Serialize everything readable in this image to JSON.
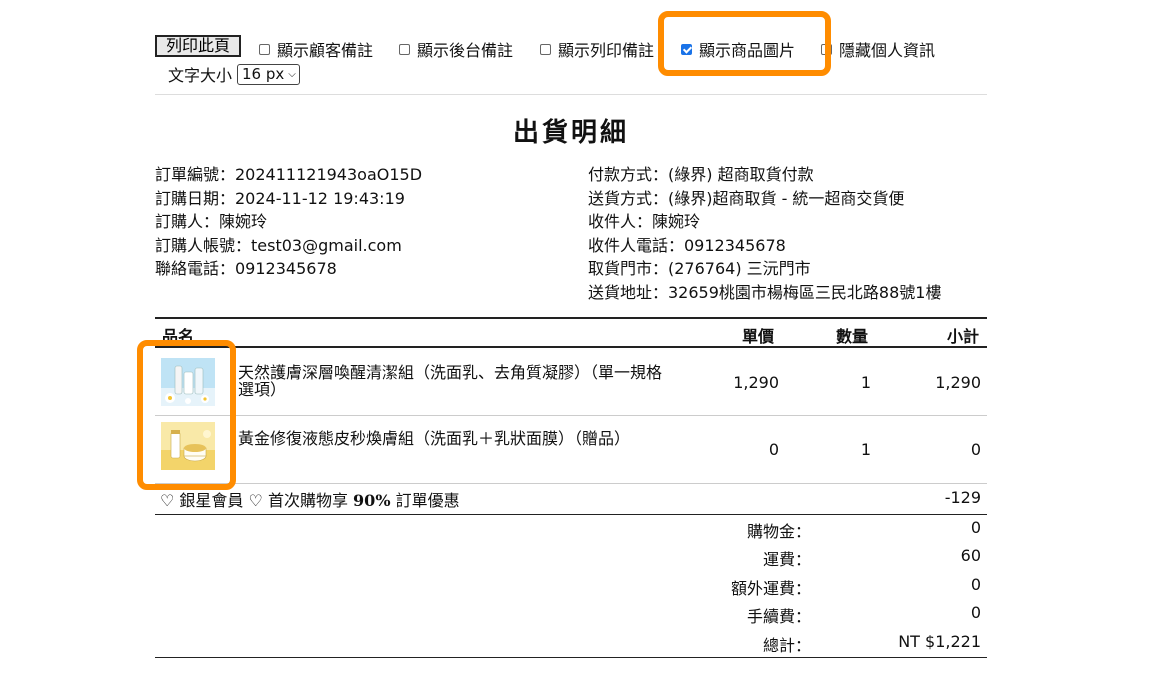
{
  "toolbar": {
    "print_button": "列印此頁",
    "options": [
      {
        "label": "顯示顧客備註",
        "checked": false
      },
      {
        "label": "顯示後台備註",
        "checked": false
      },
      {
        "label": "顯示列印備註",
        "checked": false
      },
      {
        "label": "顯示商品圖片",
        "checked": true
      },
      {
        "label": "隱藏個人資訊",
        "checked": false
      }
    ],
    "font_size_label": "文字大小",
    "font_size_value": "16 px"
  },
  "title": "出貨明細",
  "order_info": {
    "order_no": "訂單編號：202411121943oaO15D",
    "order_date": "訂購日期：2024-11-12 19:43:19",
    "buyer": "訂購人：陳婉玲",
    "buyer_account": "訂購人帳號：test03@gmail.com",
    "contact_phone": "聯絡電話：0912345678",
    "payment": "付款方式：(綠界) 超商取貨付款",
    "shipping": "送貨方式：(綠界)超商取貨 - 統一超商交貨便",
    "receiver": "收件人：陳婉玲",
    "receiver_phone": "收件人電話：0912345678",
    "pickup_store": "取貨門市：(276764) 三沅門市",
    "address": "送貨地址：32659桃園市楊梅區三民北路88號1樓"
  },
  "table": {
    "headers": {
      "name": "品名",
      "price": "單價",
      "qty": "數量",
      "subtotal": "小計"
    },
    "items": [
      {
        "name": "天然護膚深層喚醒清潔組（洗面乳、去角質凝膠）（單一規格選項）",
        "price": "1,290",
        "qty": "1",
        "subtotal": "1,290",
        "thumb": "skincare-cleanser-set"
      },
      {
        "name": "黃金修復液態皮秒煥膚組（洗面乳＋乳狀面膜）（贈品）",
        "price": "0",
        "qty": "1",
        "subtotal": "0",
        "thumb": "golden-repair-set"
      }
    ],
    "promo": {
      "prefix": "♡ 銀星會員 ♡ 首次購物享 ",
      "bold": "90%",
      "suffix": " 訂單優惠",
      "amount": "-129"
    }
  },
  "summary": [
    {
      "label": "購物金：",
      "value": "0"
    },
    {
      "label": "運費：",
      "value": "60"
    },
    {
      "label": "額外運費：",
      "value": "0"
    },
    {
      "label": "手續費：",
      "value": "0"
    },
    {
      "label": "總計：",
      "value": "NT $1,221"
    }
  ],
  "colors": {
    "highlight": "#ff8c00",
    "checkbox": "#1a73e8"
  }
}
